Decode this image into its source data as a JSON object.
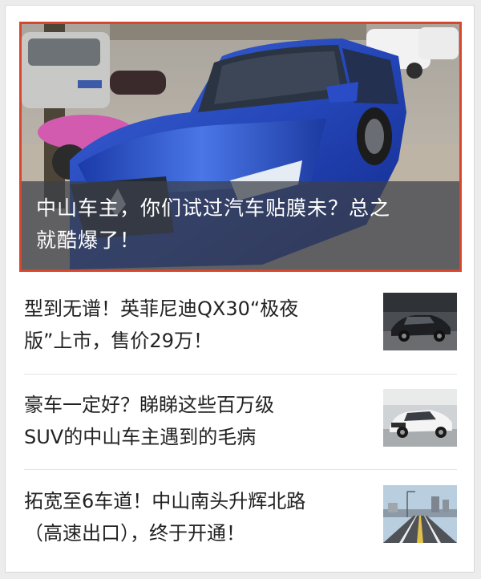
{
  "hero": {
    "title_line1": "中山车主，你们试过汽车贴膜未？总之",
    "title_line2": "就酷爆了！"
  },
  "articles": [
    {
      "title_line1": "型到无谱！英菲尼迪QX30“极夜",
      "title_line2": "版”上市，售价29万！",
      "thumb_icon": "dark-suv-photo"
    },
    {
      "title_line1": "豪车一定好？睇睇这些百万级",
      "title_line2": "SUV的中山车主遇到的毛病",
      "thumb_icon": "white-suv-photo"
    },
    {
      "title_line1": "拓宽至6车道！中山南头升辉北路",
      "title_line2": "（高速出口），终于开通！",
      "thumb_icon": "road-photo"
    }
  ],
  "colors": {
    "highlight_border": "#d9462e",
    "text": "#222222"
  }
}
